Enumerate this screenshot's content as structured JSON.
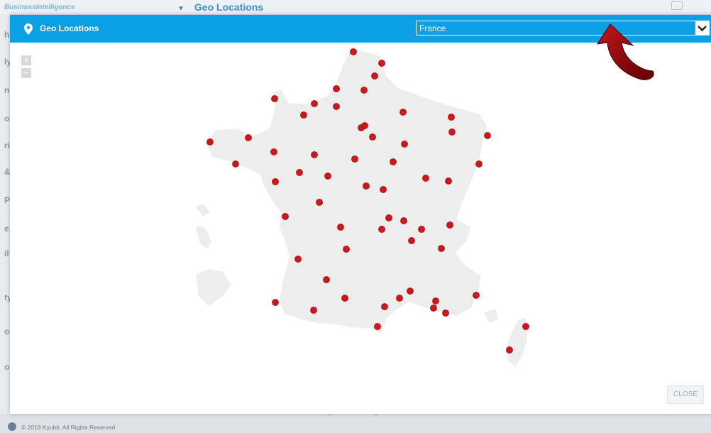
{
  "background": {
    "brand": "BusinessIntelligence",
    "page_title": "Geo Locations",
    "footer_copyright": "© 2018 Kyubit, All Rights Reserved",
    "footer_more": "Find more information on Geo Member usage and management"
  },
  "modal": {
    "title": "Geo Locations",
    "selected_country": "France",
    "close_label": "CLOSE"
  },
  "zoom": {
    "in_label": "+",
    "out_label": "−"
  },
  "colors": {
    "header": "#0b9fe4",
    "marker": "#d0161a",
    "map_fill": "#ededee",
    "annotation_arrow": "#8b0000"
  },
  "map": {
    "country": "France",
    "marker_count": 67
  },
  "icons": {
    "pin": "map-pin-icon",
    "dropdown": "chevron-down-icon",
    "annotation": "curved-arrow-icon"
  }
}
